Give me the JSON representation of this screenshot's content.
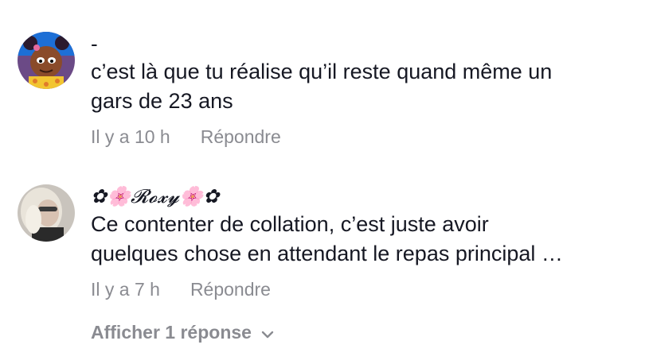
{
  "comments": [
    {
      "username": "-",
      "text_lines": [
        "c’est là que tu réalise qu’il reste quand même un",
        "gars de 23 ans"
      ],
      "time": "Il y a 10 h",
      "reply_label": "Répondre"
    },
    {
      "username": "✿🌸𝓡𝓸𝔁𝔂🌸✿",
      "text_lines": [
        "Ce contenter de collation, c’est juste avoir",
        "quelques chose en attendant le repas principal …"
      ],
      "time": "Il y a 7 h",
      "reply_label": "Répondre"
    }
  ],
  "view_replies": {
    "label": "Afficher 1 réponse",
    "icon": "chevron-down-icon"
  },
  "colors": {
    "text": "#161823",
    "muted": "#8a8b91"
  }
}
